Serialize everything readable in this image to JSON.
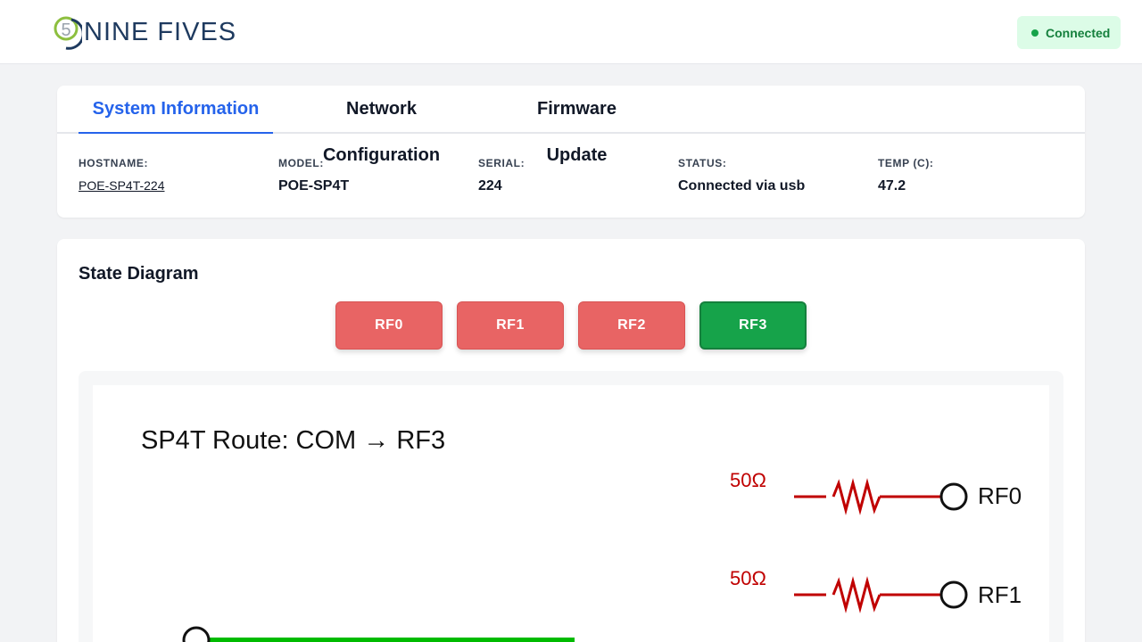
{
  "header": {
    "logo_text": "NINE FIVES",
    "logo_mark": "5",
    "connection_status": "Connected",
    "status_color": "#16a34a"
  },
  "tabs": [
    {
      "label": "System Information",
      "active": true
    },
    {
      "label": "Network Configuration",
      "active": false
    },
    {
      "label": "Firmware Update",
      "active": false
    }
  ],
  "system_info": {
    "hostname": {
      "label": "HOSTNAME:",
      "value": "POE-SP4T-224"
    },
    "model": {
      "label": "MODEL:",
      "value": "POE-SP4T"
    },
    "serial": {
      "label": "SERIAL:",
      "value": "224"
    },
    "status": {
      "label": "STATUS:",
      "value": "Connected via usb"
    },
    "temp": {
      "label": "TEMP (C):",
      "value": "47.2"
    }
  },
  "state_diagram": {
    "title": "State Diagram",
    "buttons": [
      {
        "label": "RF0",
        "active": false
      },
      {
        "label": "RF1",
        "active": false
      },
      {
        "label": "RF2",
        "active": false
      },
      {
        "label": "RF3",
        "active": true
      }
    ],
    "colors": {
      "active": "#16a34a",
      "inactive": "#e86464",
      "route": "#00bb00",
      "termination": "#c00000"
    },
    "diagram": {
      "route_title": "SP4T Route: COM → RF3",
      "ports": [
        {
          "label": "RF0",
          "termination": "50Ω"
        },
        {
          "label": "RF1",
          "termination": "50Ω"
        }
      ]
    }
  }
}
